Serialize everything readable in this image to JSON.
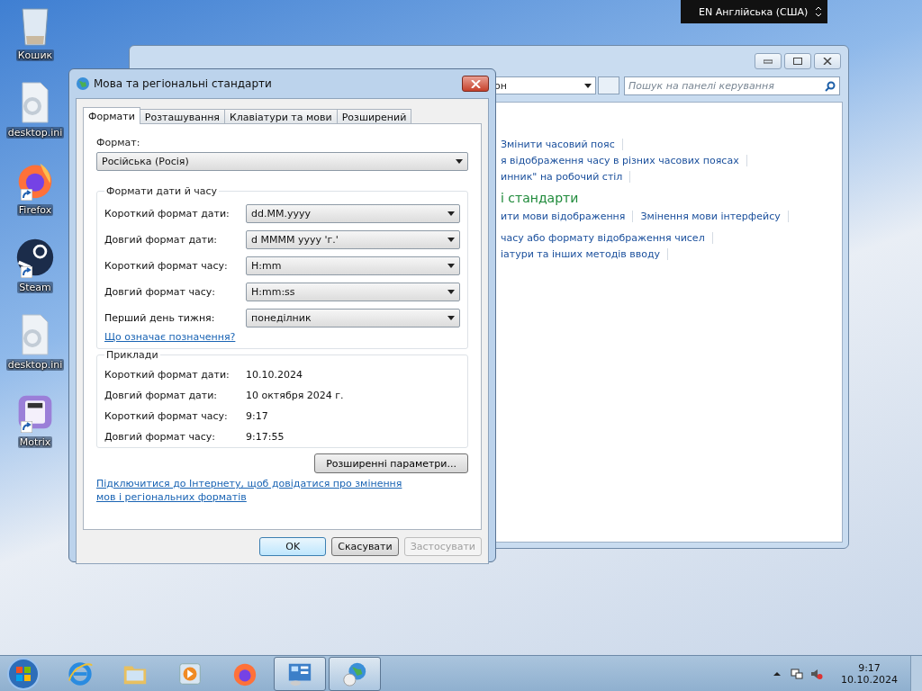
{
  "desktop_icons": [
    {
      "label": "Кошик",
      "kind": "bin",
      "shortcut": false
    },
    {
      "label": "desktop.ini",
      "kind": "file",
      "shortcut": false
    },
    {
      "label": "Firefox",
      "kind": "firefox",
      "shortcut": true
    },
    {
      "label": "Steam",
      "kind": "steam",
      "shortcut": true
    },
    {
      "label": "desktop.ini",
      "kind": "file",
      "shortcut": false
    },
    {
      "label": "Motrix",
      "kind": "motrix",
      "shortcut": true
    }
  ],
  "language_bar": {
    "label": "EN Англійська (США)"
  },
  "background_window": {
    "address": "он",
    "search": {
      "placeholder": "Пошук на панелі керування"
    },
    "sections": [
      {
        "lines": [
          [
            "Змінити часовий пояс"
          ],
          [
            "я відображення часу в різних часових поясах"
          ],
          [
            "инник\" на робочий стіл"
          ]
        ]
      },
      {
        "heading": "і стандарти",
        "lines": [
          [
            "ити мови відображення",
            "Змінення мови інтерфейсу"
          ]
        ]
      },
      {
        "lines": [
          [
            "часу або формату відображення чисел"
          ],
          [
            "іатури та інших методів вводу"
          ]
        ]
      }
    ]
  },
  "dialog": {
    "title": "Мова та регіональні стандарти",
    "tabs": [
      {
        "label": "Формати",
        "selected": true
      },
      {
        "label": "Розташування",
        "selected": false
      },
      {
        "label": "Клавіатури та мови",
        "selected": false
      },
      {
        "label": "Розширений",
        "selected": false
      }
    ],
    "format_label": "Формат:",
    "format_value": "Російська (Росія)",
    "formats_group": {
      "title": "Формати дати й часу",
      "rows": [
        {
          "label": "Короткий формат дати:",
          "value": "dd.MM.yyyy"
        },
        {
          "label": "Довгий формат дати:",
          "value": "d MMMM yyyy 'г.'"
        },
        {
          "label": "Короткий формат часу:",
          "value": "H:mm"
        },
        {
          "label": "Довгий формат часу:",
          "value": "H:mm:ss"
        },
        {
          "label": "Перший день тижня:",
          "value": "понеділник"
        }
      ],
      "link": "Що означає позначення?"
    },
    "examples": {
      "title": "Приклади",
      "rows": [
        {
          "label": "Короткий формат дати:",
          "value": "10.10.2024"
        },
        {
          "label": "Довгий формат дати:",
          "value": "10 октября 2024 г."
        },
        {
          "label": "Короткий формат часу:",
          "value": "9:17"
        },
        {
          "label": "Довгий формат часу:",
          "value": "9:17:55"
        }
      ]
    },
    "advanced_button": "Розширенні параметри...",
    "footer_link": "Підключитися до Інтернету, щоб довідатися про змінення мов і регіональних форматів",
    "buttons": [
      {
        "label": "OK",
        "default": true,
        "disabled": false
      },
      {
        "label": "Скасувати",
        "default": false,
        "disabled": false
      },
      {
        "label": "Застосувати",
        "default": false,
        "disabled": true
      }
    ]
  },
  "taskbar": {
    "items": [
      {
        "kind": "ie",
        "active": false
      },
      {
        "kind": "explorer",
        "active": false
      },
      {
        "kind": "media",
        "active": false
      },
      {
        "kind": "firefox",
        "active": false
      },
      {
        "kind": "control-panel",
        "active": true
      },
      {
        "kind": "globe",
        "active": true
      }
    ],
    "time": "9:17",
    "date": "10.10.2024"
  }
}
